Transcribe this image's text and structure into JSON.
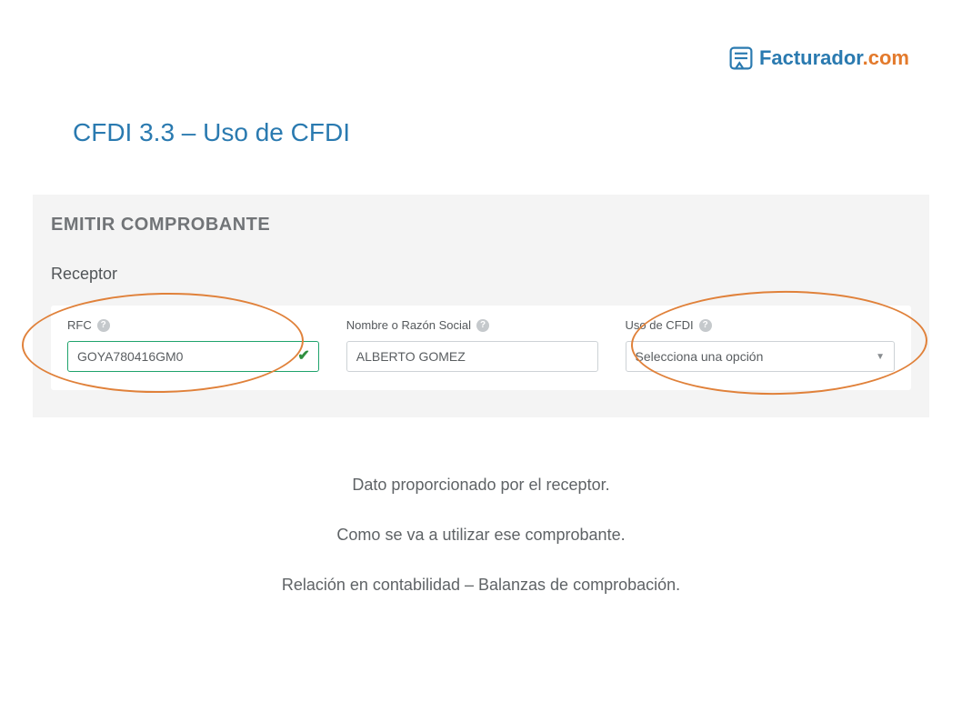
{
  "logo": {
    "name_part1": "Facturador",
    "name_part2": ".com"
  },
  "page_title": "CFDI 3.3 – Uso de CFDI",
  "panel": {
    "title": "EMITIR COMPROBANTE",
    "section": "Receptor",
    "fields": {
      "rfc": {
        "label": "RFC",
        "value": "GOYA780416GM0"
      },
      "nombre": {
        "label": "Nombre o Razón Social",
        "value": "ALBERTO GOMEZ"
      },
      "uso": {
        "label": "Uso de CFDI",
        "placeholder": "Selecciona una opción"
      }
    }
  },
  "description": {
    "line1": "Dato proporcionado por el receptor.",
    "line2": "Como se va a utilizar ese comprobante.",
    "line3": "Relación en contabilidad – Balanzas de comprobación."
  }
}
